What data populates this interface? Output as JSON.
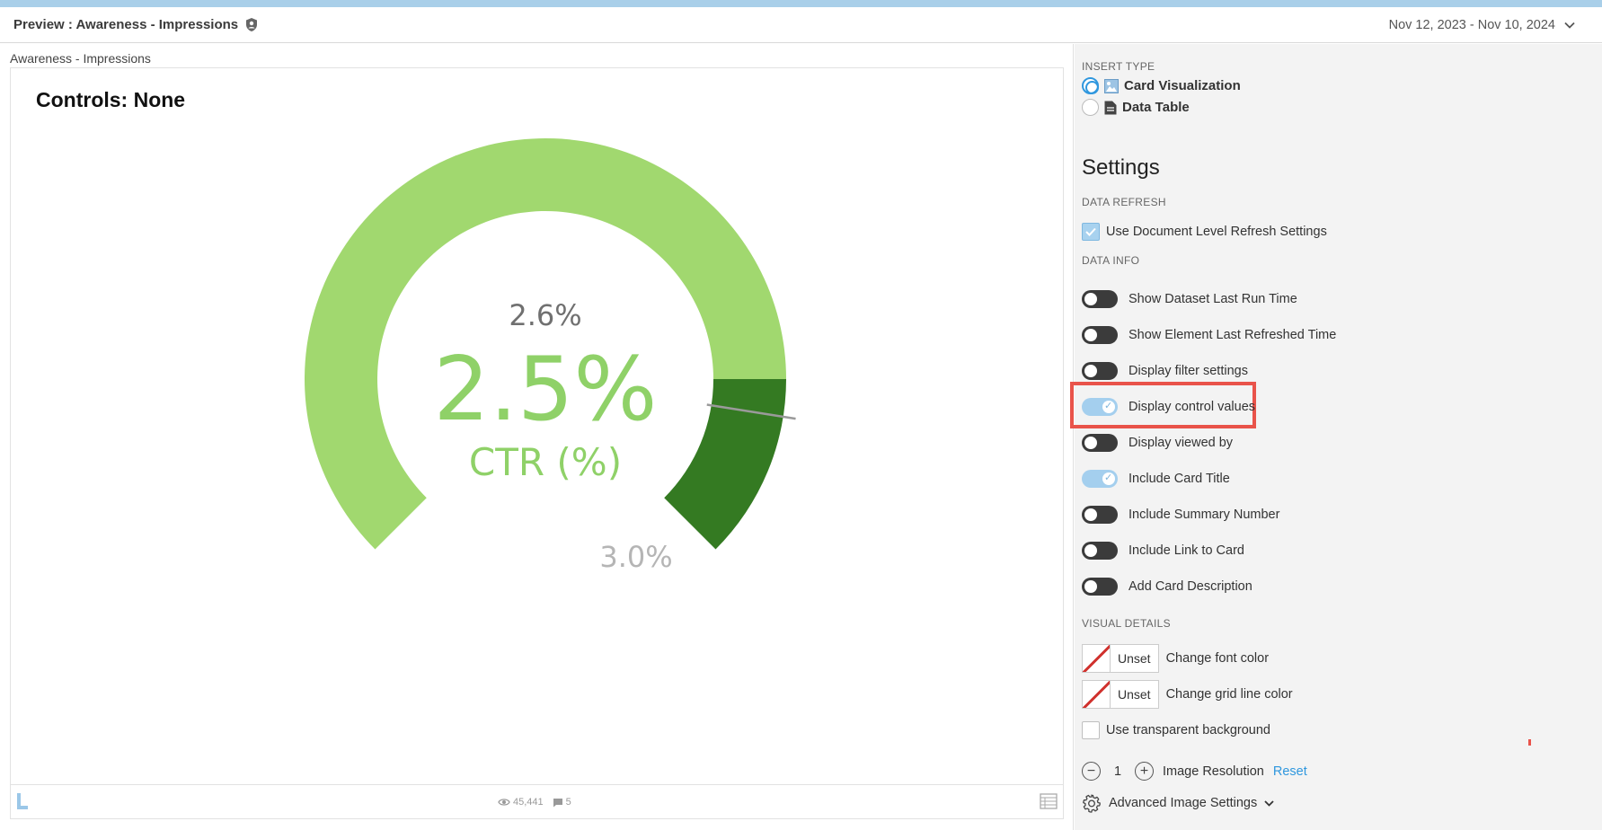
{
  "header": {
    "title": "Preview : Awareness - Impressions",
    "date_range": "Nov 12, 2023 - Nov 10, 2024"
  },
  "preview": {
    "breadcrumb": "Awareness - Impressions",
    "card_title": "Controls: None",
    "footer": {
      "views": "45,441",
      "comments": "5"
    }
  },
  "chart_data": {
    "type": "gauge",
    "value_label": "2.5%",
    "value": 2.5,
    "metric_label": "CTR (%)",
    "target_label": "2.6%",
    "target": 2.6,
    "max_label": "3.0%",
    "max": 3.0,
    "colors": {
      "light": "#a1d86f",
      "dark": "#347a22",
      "text_value": "#8fd168",
      "text_target": "#707070",
      "text_max": "#b5b5b5"
    }
  },
  "panel": {
    "insert_type_heading": "INSERT TYPE",
    "insert_options": [
      {
        "label": "Card Visualization",
        "selected": true
      },
      {
        "label": "Data Table",
        "selected": false
      }
    ],
    "settings_heading": "Settings",
    "data_refresh_heading": "DATA REFRESH",
    "use_document_refresh": "Use Document Level Refresh Settings",
    "data_info_heading": "DATA INFO",
    "toggles": [
      {
        "label": "Show Dataset Last Run Time",
        "on": false
      },
      {
        "label": "Show Element Last Refreshed Time",
        "on": false
      },
      {
        "label": "Display filter settings",
        "on": false
      },
      {
        "label": "Display control values",
        "on": true
      },
      {
        "label": "Display viewed by",
        "on": false
      },
      {
        "label": "Include Card Title",
        "on": true
      },
      {
        "label": "Include Summary Number",
        "on": false
      },
      {
        "label": "Include Link to Card",
        "on": false
      },
      {
        "label": "Add Card Description",
        "on": false
      }
    ],
    "visual_details_heading": "VISUAL DETAILS",
    "font_color": {
      "unset": "Unset",
      "label": "Change font color"
    },
    "grid_color": {
      "unset": "Unset",
      "label": "Change grid line color"
    },
    "transparent_bg": "Use transparent background",
    "resolution": {
      "value": "1",
      "label": "Image Resolution",
      "reset": "Reset"
    },
    "advanced": "Advanced Image Settings"
  }
}
